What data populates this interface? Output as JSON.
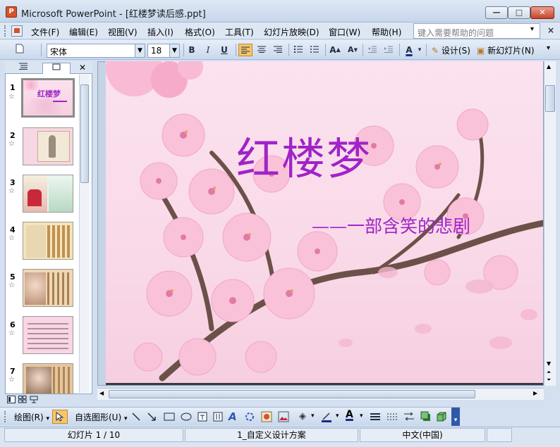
{
  "window": {
    "app_icon": "P",
    "title": "Microsoft PowerPoint - [红楼梦读后感.ppt]",
    "min_glyph": "—",
    "max_glyph": "□",
    "close_glyph": "✕"
  },
  "menu": {
    "items": [
      "文件(F)",
      "编辑(E)",
      "视图(V)",
      "插入(I)",
      "格式(O)",
      "工具(T)",
      "幻灯片放映(D)",
      "窗口(W)",
      "帮助(H)"
    ],
    "help_placeholder": "键入需要帮助的问题",
    "help_arrow": "▾",
    "close_glyph": "×"
  },
  "toolbar": {
    "font_name": "宋体",
    "font_size": "18",
    "bold": "B",
    "italic": "I",
    "underline": "U",
    "font_color": "A",
    "design_label": "设计(S)",
    "new_slide_label": "新幻灯片(N)"
  },
  "thumbnails": {
    "slides": [
      {
        "number": "1",
        "title": "红楼梦"
      },
      {
        "number": "2"
      },
      {
        "number": "3"
      },
      {
        "number": "4"
      },
      {
        "number": "5"
      },
      {
        "number": "6"
      },
      {
        "number": "7"
      }
    ],
    "star": "☆"
  },
  "slide": {
    "title": "红楼梦",
    "subtitle": "——一部含笑的悲剧",
    "title_color": "#a023c8"
  },
  "drawing": {
    "draw_label": "绘图(R)",
    "autoshapes_label": "自选图形(U)"
  },
  "status": {
    "slide_position": "幻灯片 1 / 10",
    "design_name": "1_自定义设计方案",
    "language": "中文(中国)"
  }
}
